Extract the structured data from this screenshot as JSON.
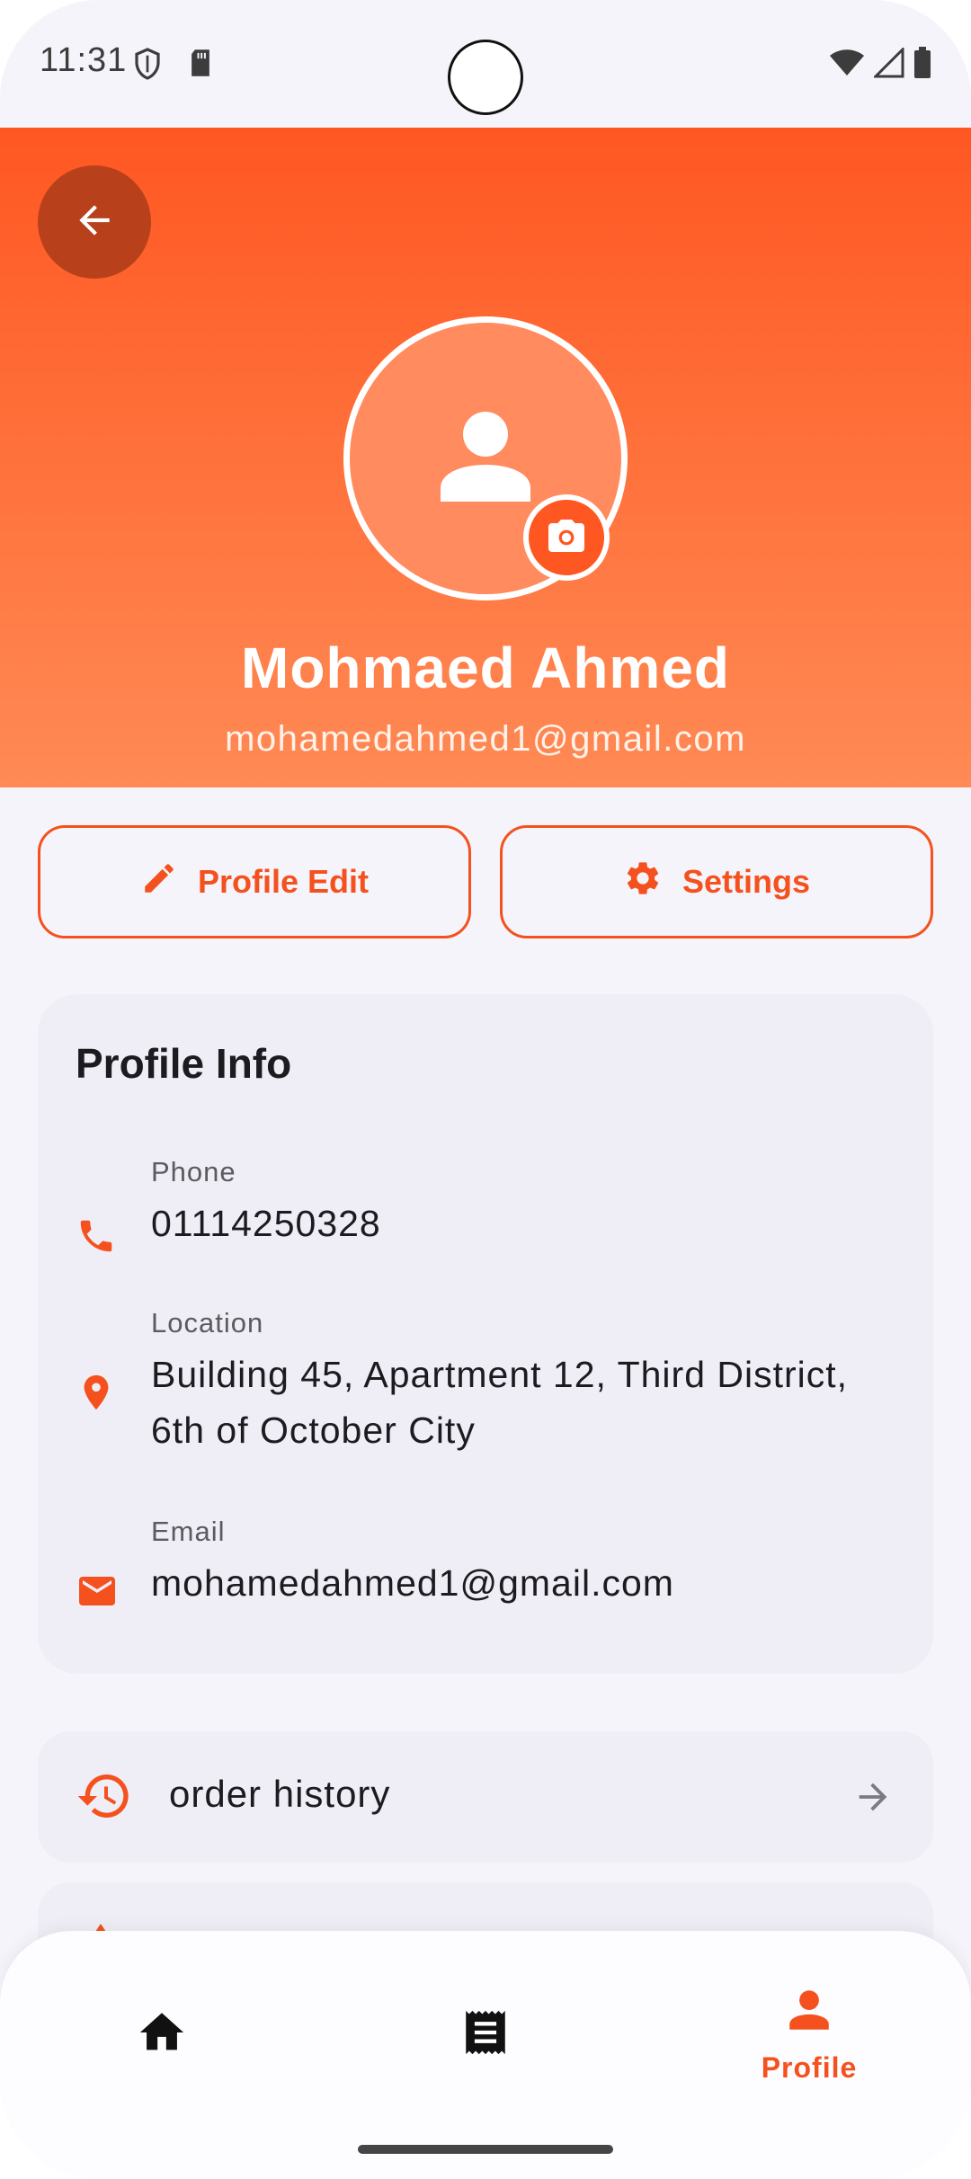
{
  "status_bar": {
    "time": "11:31",
    "icons": [
      "shield-icon",
      "sd-card-icon",
      "wifi-icon",
      "signal-icon",
      "battery-icon"
    ]
  },
  "header": {
    "back_icon": "arrow-back-icon",
    "avatar_icon": "person-icon",
    "camera_icon": "camera-icon",
    "name": "Mohmaed Ahmed",
    "email": "mohamedahmed1@gmail.com",
    "gradient_colors": [
      "#ff5722",
      "#ff8a55"
    ]
  },
  "actions": {
    "edit_label": "Profile Edit",
    "edit_icon": "pencil-icon",
    "settings_label": "Settings",
    "settings_icon": "gear-icon"
  },
  "profile_info": {
    "title": "Profile Info",
    "fields": [
      {
        "label": "Phone",
        "value": "01114250328",
        "icon": "phone-icon"
      },
      {
        "label": "Location",
        "value": "Building 45, Apartment 12, Third District, 6th of October City",
        "icon": "location-pin-icon"
      },
      {
        "label": "Email",
        "value": "mohamedahmed1@gmail.com",
        "icon": "mail-icon"
      }
    ]
  },
  "menu": {
    "items": [
      {
        "label": "order history",
        "icon": "history-icon",
        "trailing_icon": "arrow-forward-icon"
      }
    ]
  },
  "bottom_nav": {
    "items": [
      {
        "id": "home",
        "icon": "home-icon",
        "label": "",
        "active": false
      },
      {
        "id": "orders",
        "icon": "receipt-icon",
        "label": "",
        "active": false
      },
      {
        "id": "profile",
        "icon": "person-icon",
        "label": "Profile",
        "active": true
      }
    ]
  },
  "colors": {
    "accent": "#f4511e",
    "header_top": "#ff5722",
    "card_bg": "#efeef6",
    "page_bg": "#f5f4fa"
  }
}
